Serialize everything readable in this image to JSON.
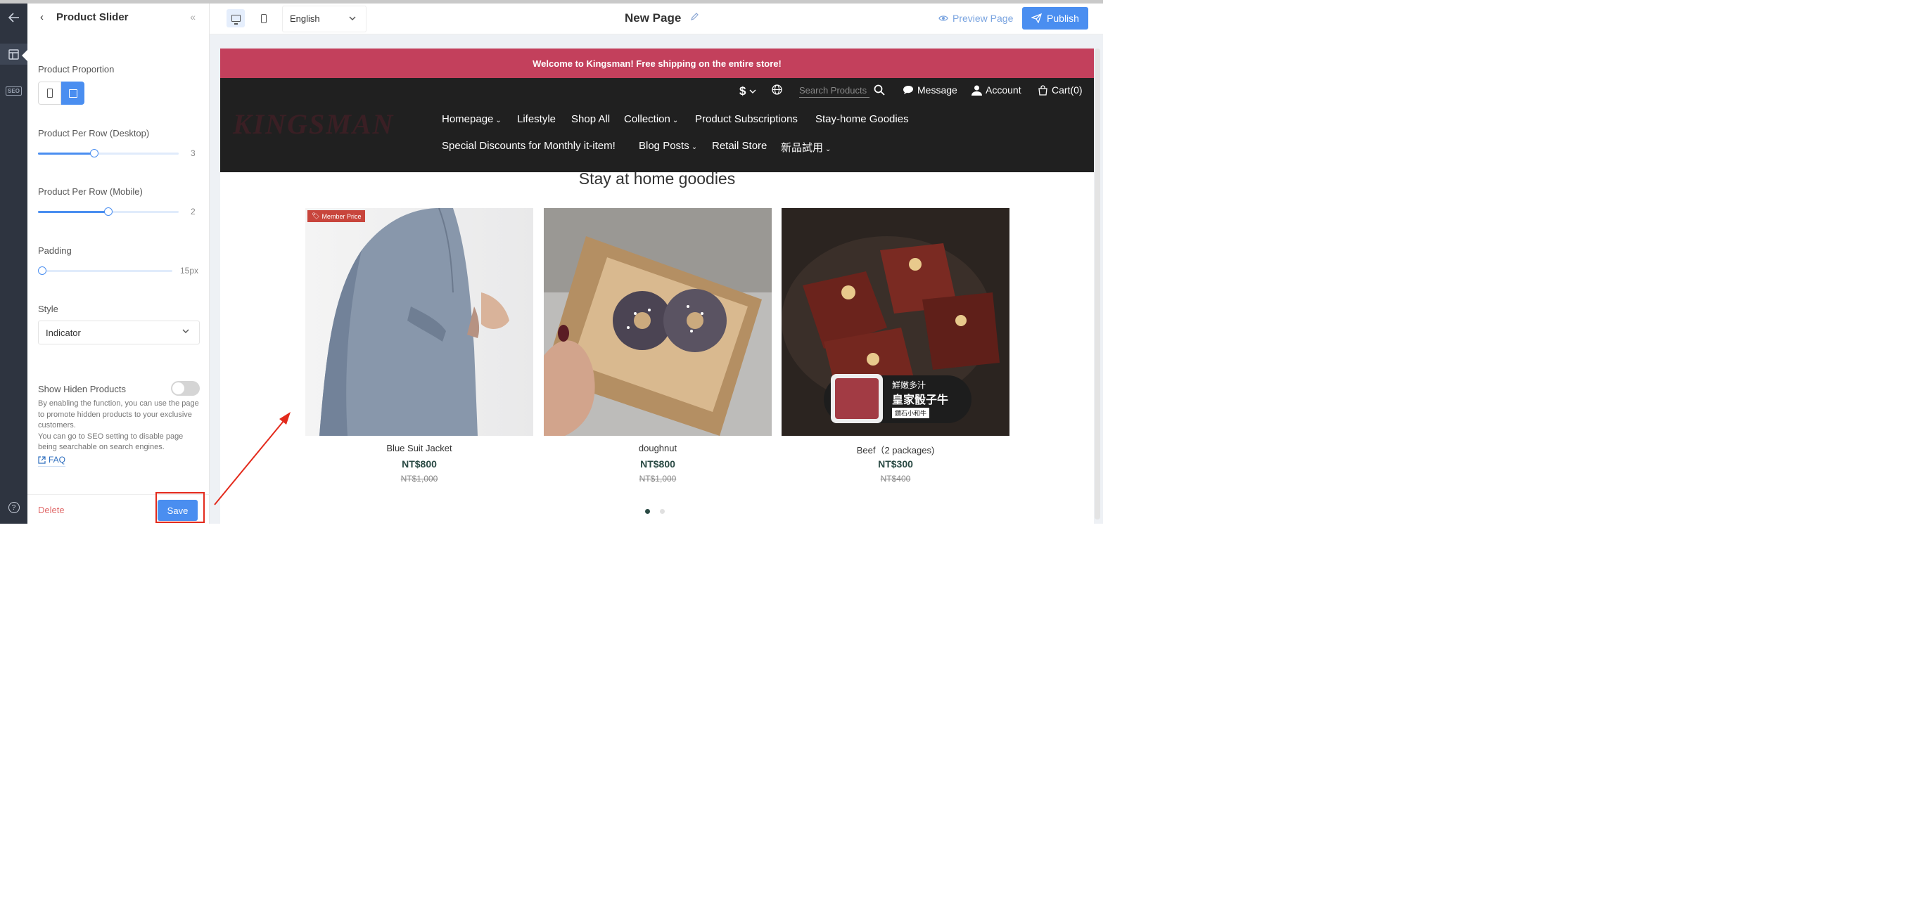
{
  "rail": {
    "back_icon": "arrow-left-icon",
    "layout_icon": "layout-icon",
    "seo_label": "SEO",
    "help_label": "?"
  },
  "panel": {
    "back_glyph": "‹",
    "title": "Product Slider",
    "collapse_glyph": "«",
    "proportion_label": "Product Proportion",
    "per_row_desktop_label": "Product Per Row (Desktop)",
    "per_row_desktop_value": "3",
    "per_row_desktop_fill": 0.4,
    "per_row_mobile_label": "Product Per Row (Mobile)",
    "per_row_mobile_value": "2",
    "per_row_mobile_fill": 0.5,
    "padding_label": "Padding",
    "padding_value": "15px",
    "padding_fill": 0.0,
    "style_label": "Style",
    "style_value": "Indicator",
    "show_hidden_label": "Show Hiden Products",
    "show_hidden_on": false,
    "desc_1": "By enabling the function, you can use the page to promote hidden products to your exclusive customers.",
    "desc_2": "You can go to SEO setting to disable page being searchable on search engines.",
    "faq_label": "FAQ",
    "delete_label": "Delete",
    "save_label": "Save"
  },
  "topbar": {
    "language": "English",
    "page_name": "New Page",
    "preview_label": "Preview Page",
    "publish_label": "Publish"
  },
  "site": {
    "announcement": "Welcome to Kingsman! Free shipping on the entire store!",
    "logo": "KINGSMAN",
    "currency": "$",
    "search_placeholder": "Search Products",
    "message_label": "Message",
    "account_label": "Account",
    "cart_label": "Cart(0)",
    "nav_row1": [
      "Homepage",
      "Lifestyle",
      "Shop All",
      "Collection",
      "Product Subscriptions",
      "Stay-home Goodies"
    ],
    "nav_row2": [
      "Special Discounts for Monthly it-item!",
      "Blog Posts",
      "Retail Store",
      "新品試用"
    ],
    "section_title": "Stay at home goodies",
    "products": [
      {
        "name": "Blue Suit Jacket",
        "price": "NT$800",
        "original": "NT$1,000",
        "badge": "Member Price"
      },
      {
        "name": "doughnut",
        "price": "NT$800",
        "original": "NT$1,000"
      },
      {
        "name": "Beef（2 packages)",
        "price": "NT$300",
        "original": "NT$400",
        "image_text_1": "鮮嫩多汁",
        "image_text_2": "皇家骰子牛",
        "image_text_3": "鑽石小和牛"
      }
    ],
    "slide_index": 1,
    "slide_count": 2
  },
  "colors": {
    "accent": "#4a8ef0",
    "announcement_bg": "#c3405c",
    "header_bg": "#202020",
    "price": "#2a4a44",
    "annotation": "#e32a1c"
  }
}
